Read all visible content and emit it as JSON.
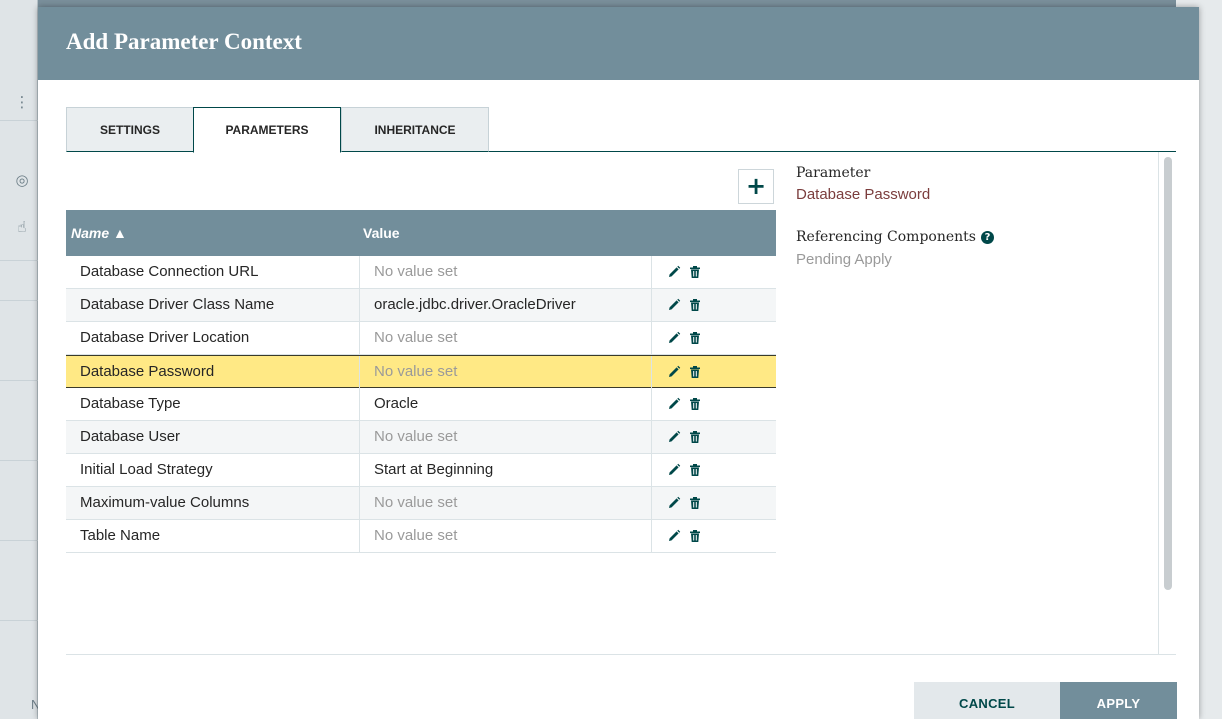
{
  "dialog": {
    "title": "Add Parameter Context"
  },
  "tabs": [
    {
      "label": "SETTINGS",
      "active": false
    },
    {
      "label": "PARAMETERS",
      "active": true
    },
    {
      "label": "INHERITANCE",
      "active": false
    }
  ],
  "add_button": {
    "label": "+",
    "icon": "plus-icon"
  },
  "table": {
    "columns": {
      "name": "Name ▲",
      "value": "Value"
    },
    "rows": [
      {
        "name": "Database Connection URL",
        "value": "No value set",
        "empty": true
      },
      {
        "name": "Database Driver Class Name",
        "value": "oracle.jdbc.driver.OracleDriver",
        "empty": false
      },
      {
        "name": "Database Driver Location",
        "value": "No value set",
        "empty": true
      },
      {
        "name": "Database Password",
        "value": "No value set",
        "empty": true,
        "selected": true
      },
      {
        "name": "Database Type",
        "value": "Oracle",
        "empty": false
      },
      {
        "name": "Database User",
        "value": "No value set",
        "empty": true
      },
      {
        "name": "Initial Load Strategy",
        "value": "Start at Beginning",
        "empty": false
      },
      {
        "name": "Maximum-value Columns",
        "value": "No value set",
        "empty": true
      },
      {
        "name": "Table Name",
        "value": "No value set",
        "empty": true
      }
    ],
    "row_actions": [
      "pencil-icon",
      "trash-icon"
    ]
  },
  "detail": {
    "parameter_label": "Parameter",
    "parameter_value": "Database Password",
    "referencing_label": "Referencing Components",
    "referencing_value": "Pending Apply"
  },
  "footer": {
    "cancel_label": "CANCEL",
    "apply_label": "APPLY"
  },
  "background": {
    "corner_letter": "N"
  },
  "colors": {
    "header": "#728e9b",
    "accent": "#004849",
    "selected_row": "#ffe985",
    "parameter_value": "#7b3d3d"
  }
}
